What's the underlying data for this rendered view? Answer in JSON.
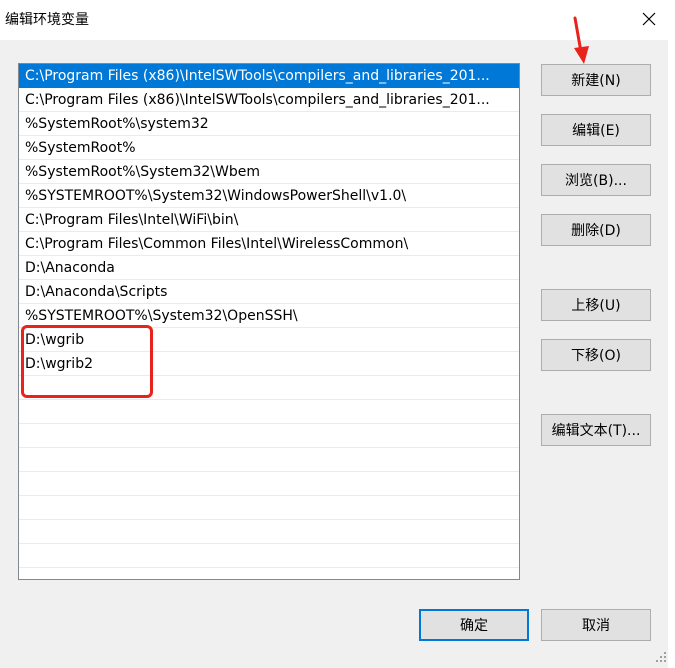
{
  "window": {
    "title": "编辑环境变量"
  },
  "list": {
    "items": [
      "C:\\Program Files (x86)\\IntelSWTools\\compilers_and_libraries_201...",
      "C:\\Program Files (x86)\\IntelSWTools\\compilers_and_libraries_201...",
      "%SystemRoot%\\system32",
      "%SystemRoot%",
      "%SystemRoot%\\System32\\Wbem",
      "%SYSTEMROOT%\\System32\\WindowsPowerShell\\v1.0\\",
      "C:\\Program Files\\Intel\\WiFi\\bin\\",
      "C:\\Program Files\\Common Files\\Intel\\WirelessCommon\\",
      "D:\\Anaconda",
      "D:\\Anaconda\\Scripts",
      "%SYSTEMROOT%\\System32\\OpenSSH\\",
      "D:\\wgrib",
      "D:\\wgrib2",
      "",
      "",
      "",
      "",
      "",
      "",
      "",
      "",
      ""
    ],
    "selected_index": 0
  },
  "buttons": {
    "new": "新建(N)",
    "edit": "编辑(E)",
    "browse": "浏览(B)...",
    "delete": "删除(D)",
    "move_up": "上移(U)",
    "move_down": "下移(O)",
    "edit_text": "编辑文本(T)...",
    "ok": "确定",
    "cancel": "取消"
  },
  "colors": {
    "selection": "#0078d7",
    "annotation": "#e8231b"
  }
}
